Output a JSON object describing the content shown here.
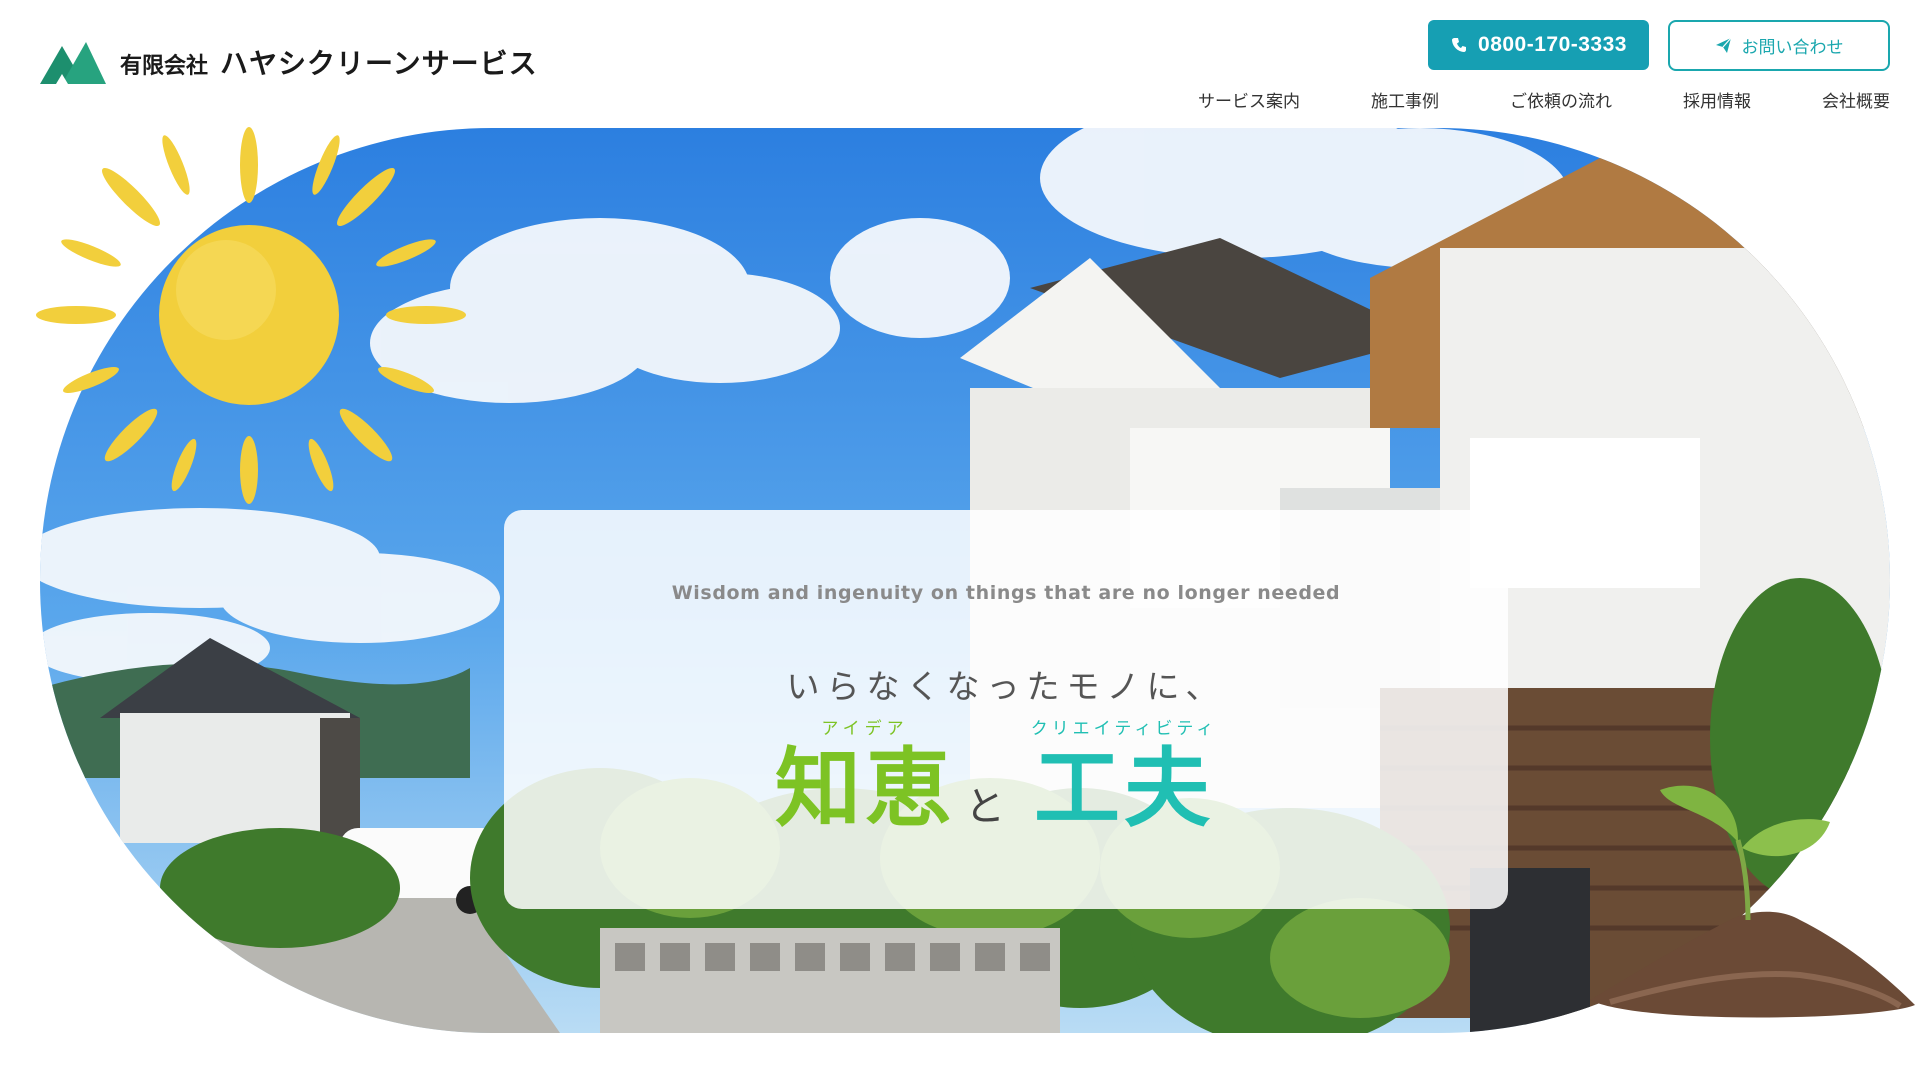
{
  "header": {
    "logo": {
      "icon": "mountain-logo-icon",
      "prefix": "有限会社",
      "name": "ハヤシクリーンサービス"
    },
    "phone": {
      "icon": "phone-icon",
      "label": "0800-170-3333"
    },
    "contact": {
      "icon": "paper-plane-icon",
      "label": "お問い合わせ"
    },
    "nav": [
      "サービス案内",
      "施工事例",
      "ご依頼の流れ",
      "採用情報",
      "会社概要"
    ]
  },
  "hero": {
    "subtitle": "Wisdom and ingenuity on things that are no longer needed",
    "lead": "いらなくなったモノに、",
    "word1": {
      "ruby": "アイデア",
      "text": "知恵"
    },
    "connector": "と",
    "word2": {
      "ruby": "クリエイティビティ",
      "text": "工夫"
    }
  },
  "colors": {
    "accent_teal": "#169fb3",
    "chie_green": "#7dc324",
    "kufu_teal": "#20bfb3",
    "sun_yellow": "#f2cf3c"
  }
}
